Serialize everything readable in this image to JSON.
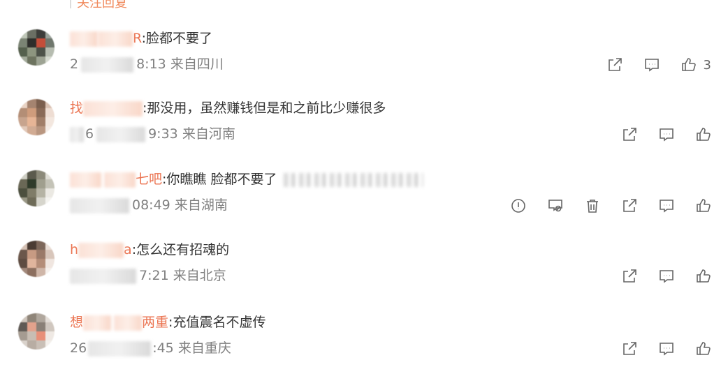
{
  "top_partial_text": "关注回复",
  "comments": [
    {
      "name_start": "",
      "name_end": "R",
      "separator": ":",
      "text": "脸都不要了",
      "time": "8:13",
      "location": "来自四川",
      "time_prefix": "2",
      "likes": "3",
      "own": false
    },
    {
      "name_start": "找",
      "name_end": "",
      "separator": ":",
      "text": "那没用，虽然赚钱但是和之前比少赚很多",
      "time": "9:33",
      "location": "来自河南",
      "time_prefix": "6",
      "likes": "",
      "own": false
    },
    {
      "name_start": "",
      "name_end": "七吧",
      "separator": ":",
      "text": "你瞧瞧  脸都不要了",
      "time": "08:49",
      "location": "来自湖南",
      "time_prefix": "",
      "likes": "",
      "own": true
    },
    {
      "name_start": "h",
      "name_end": "a",
      "separator": ":",
      "text": "怎么还有招魂的",
      "time": "7:21",
      "location": "来自北京",
      "time_prefix": "",
      "likes": "",
      "own": false
    },
    {
      "name_start": "想",
      "name_end": "两重",
      "separator": ":",
      "text": "充值震名不虚传",
      "time": ":45",
      "location": "来自重庆",
      "time_prefix": "26",
      "likes": "",
      "own": false
    }
  ],
  "colors": {
    "name": "#eb7350",
    "meta": "#808080",
    "text": "#333333",
    "icon": "#666666"
  },
  "icons": [
    "share-icon",
    "comment-icon",
    "like-icon",
    "report-icon",
    "hide-icon",
    "delete-icon"
  ]
}
